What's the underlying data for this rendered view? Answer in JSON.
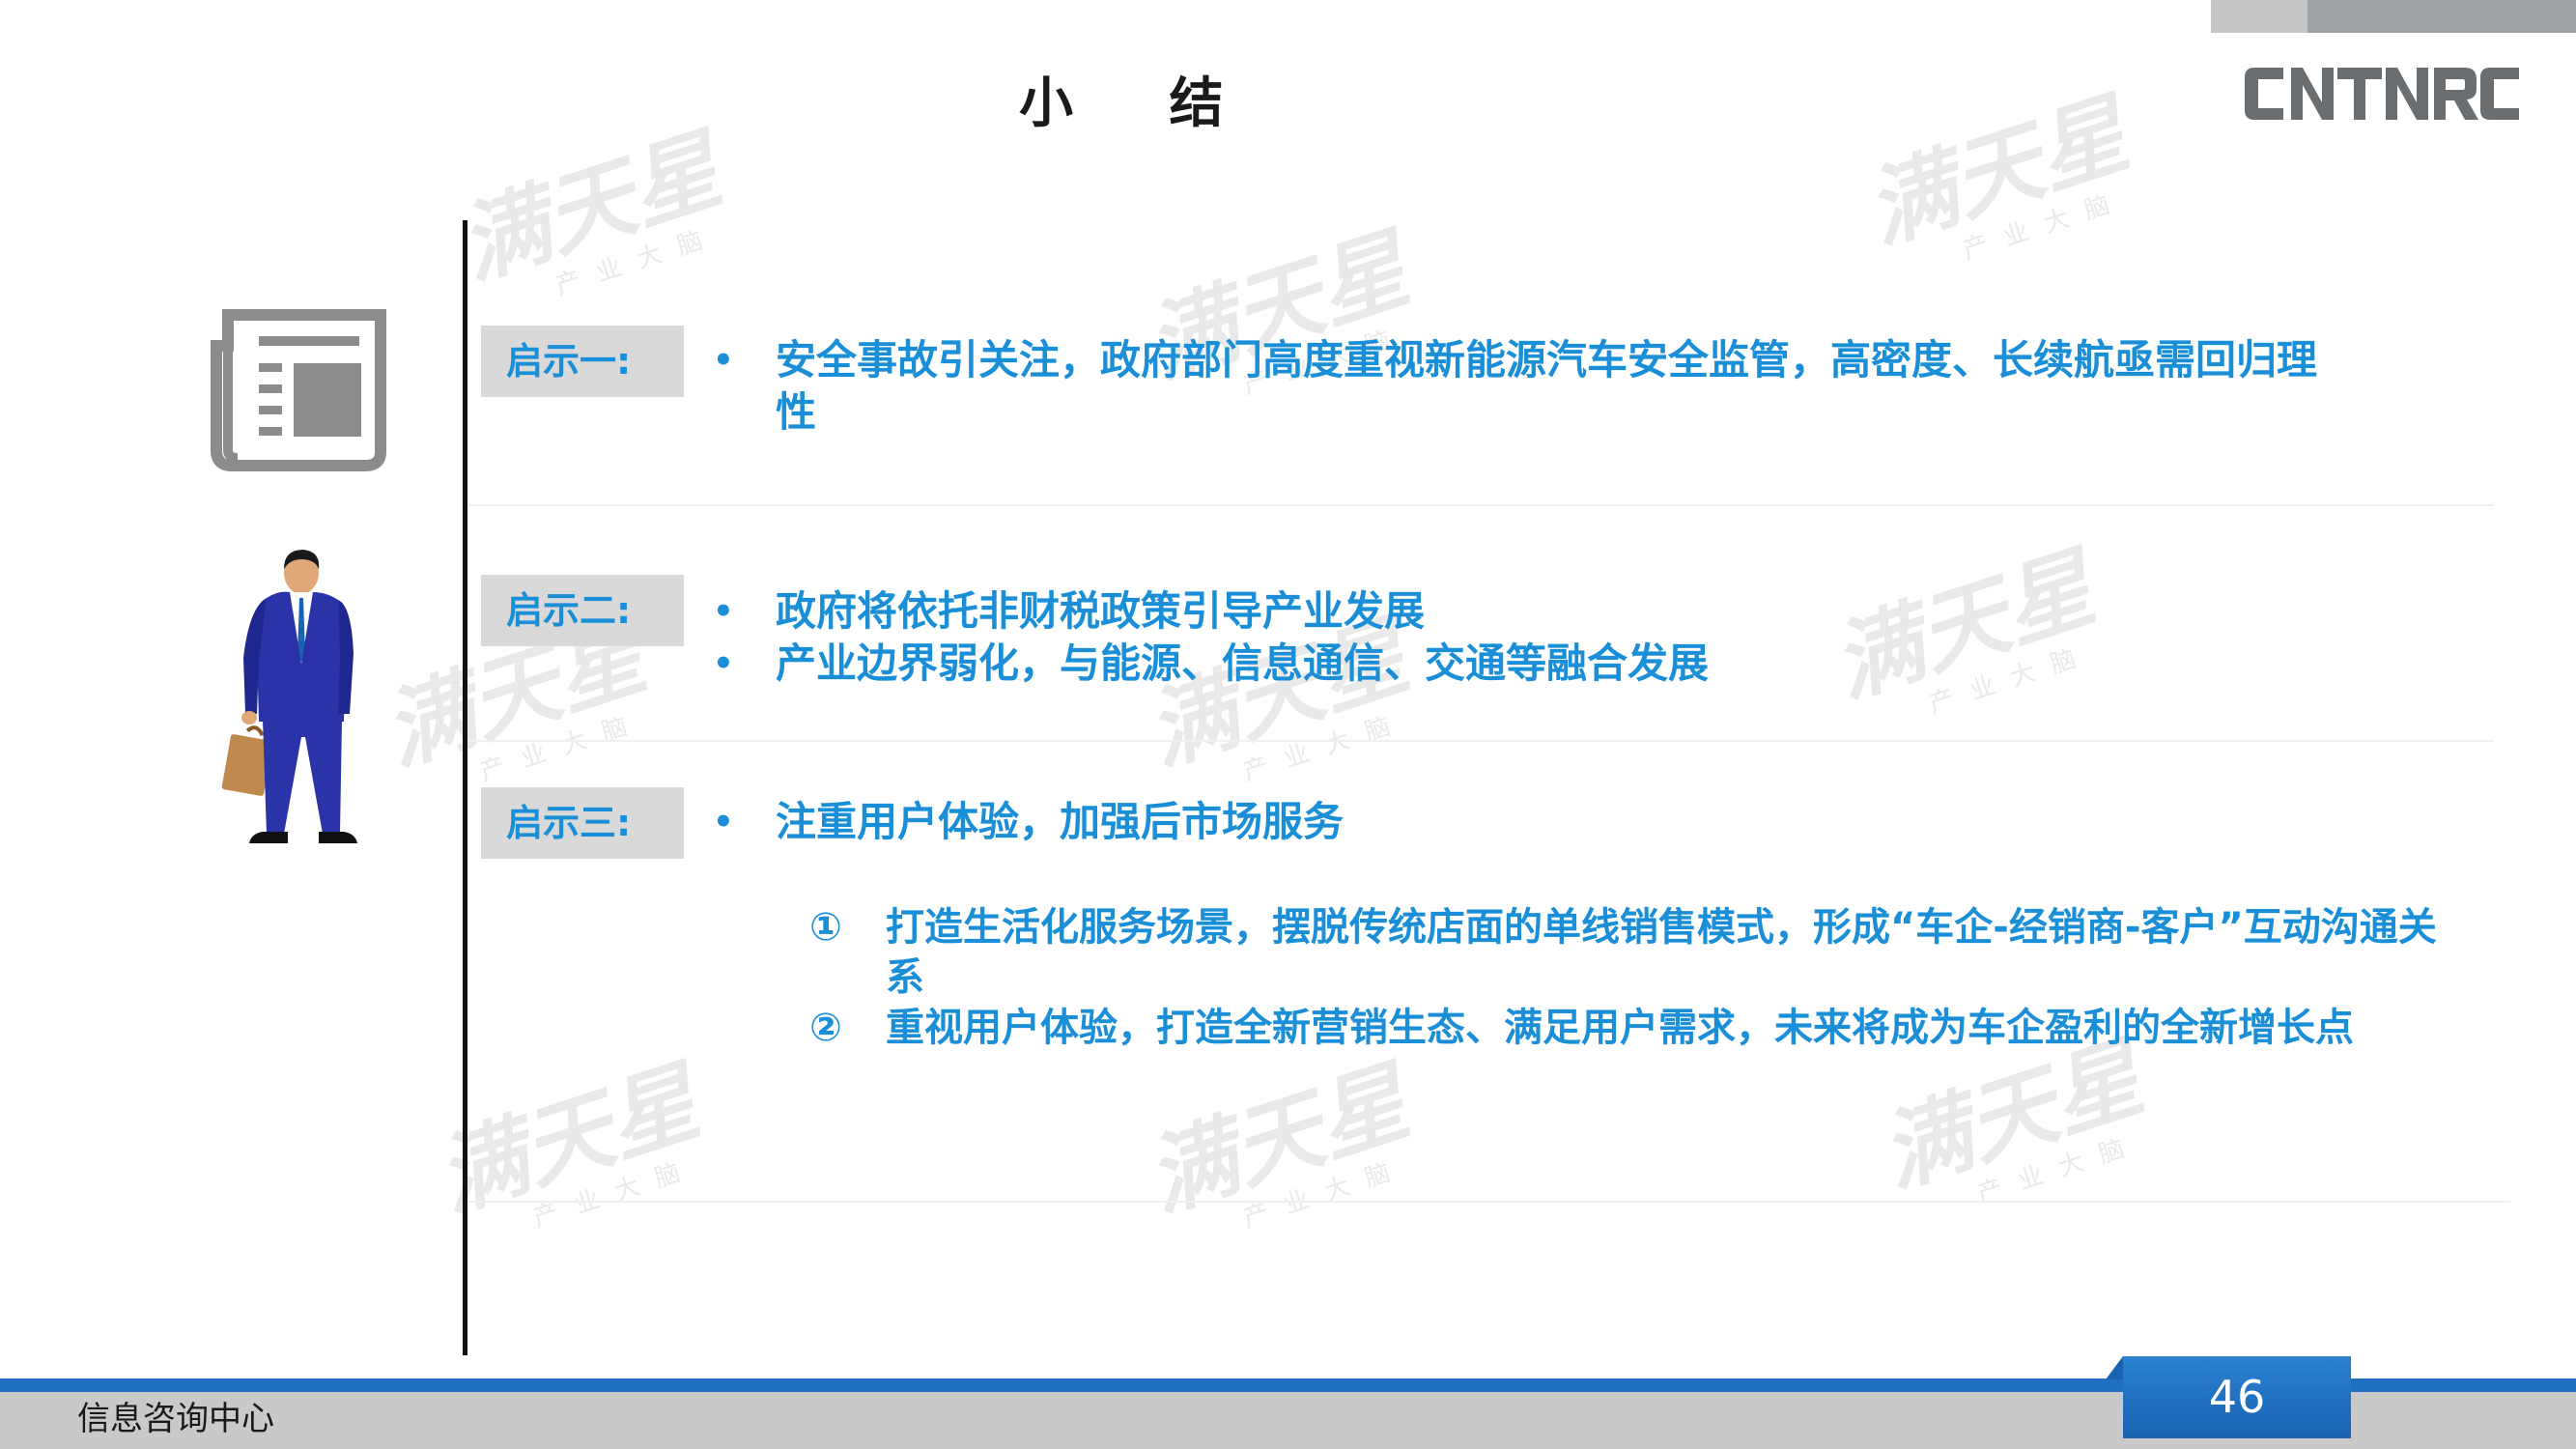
{
  "header": {
    "title": "小  结",
    "logo_text": "CATARC"
  },
  "colors": {
    "accent": "#1a8fd8",
    "tag_background": "#d9d9d9",
    "footer_blue": "#1f6fc2",
    "footer_grey": "#c9c9c9",
    "top_bar_grey": "#9fa2a5"
  },
  "icons": {
    "newspaper": "newspaper-icon",
    "businessman": "businessman-icon"
  },
  "sections": [
    {
      "tag": "启示一:",
      "bullets": [
        "安全事故引关注，政府部门高度重视新能源汽车安全监管，高密度、长续航亟需回归理性"
      ]
    },
    {
      "tag": "启示二:",
      "bullets": [
        "政府将依托非财税政策引导产业发展",
        "产业边界弱化，与能源、信息通信、交通等融合发展"
      ]
    },
    {
      "tag": "启示三:",
      "bullets": [
        "注重用户体验，加强后市场服务"
      ],
      "sub_items": [
        {
          "marker": "①",
          "text": "打造生活化服务场景，摆脱传统店面的单线销售模式，形成“车企-经销商-客户”互动沟通关系"
        },
        {
          "marker": "②",
          "text": "重视用户体验，打造全新营销生态、满足用户需求，未来将成为车企盈利的全新增长点"
        }
      ]
    }
  ],
  "bullet_symbol": "•",
  "watermark": {
    "main": "满天星",
    "sub": "产业大脑"
  },
  "footer": {
    "text": "信息咨询中心",
    "page_number": "46"
  }
}
